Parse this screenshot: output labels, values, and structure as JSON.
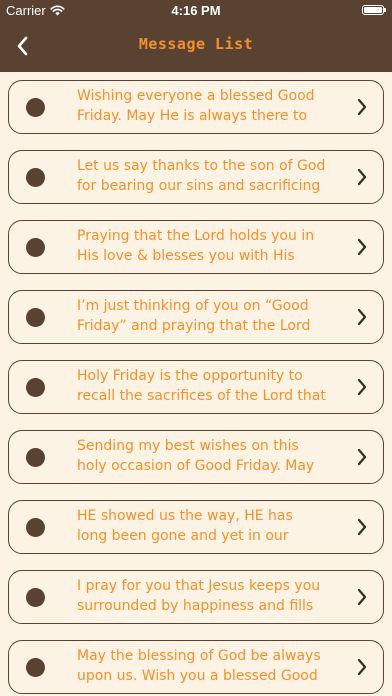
{
  "status_bar": {
    "carrier": "Carrier",
    "time": "4:16 PM"
  },
  "header": {
    "title": "Message List",
    "back_icon": "chevron-left-icon"
  },
  "colors": {
    "header_bg": "#5a4233",
    "page_bg": "#fdf3e4",
    "accent": "#f4902a",
    "card_border": "#5a4233"
  },
  "messages": [
    {
      "text": "Wishing everyone a blessed Good Friday. May He is always there to"
    },
    {
      "text": "Let us say thanks to the son of God for bearing our sins and sacrificing"
    },
    {
      "text": "Praying that the Lord holds you in His love & blesses you with His"
    },
    {
      "text": "I’m just thinking of you on “Good Friday” and praying that the Lord"
    },
    {
      "text": "Holy Friday is the opportunity to recall the sacrifices of the Lord that"
    },
    {
      "text": "Sending my best wishes on this holy occasion of Good Friday. May"
    },
    {
      "text": "HE showed us the way, HE has long been gone and yet in our hearts,"
    },
    {
      "text": "I pray for you that Jesus keeps you surrounded by happiness and fills"
    },
    {
      "text": "May the blessing of God be always upon us. Wish you a blessed Good"
    }
  ]
}
